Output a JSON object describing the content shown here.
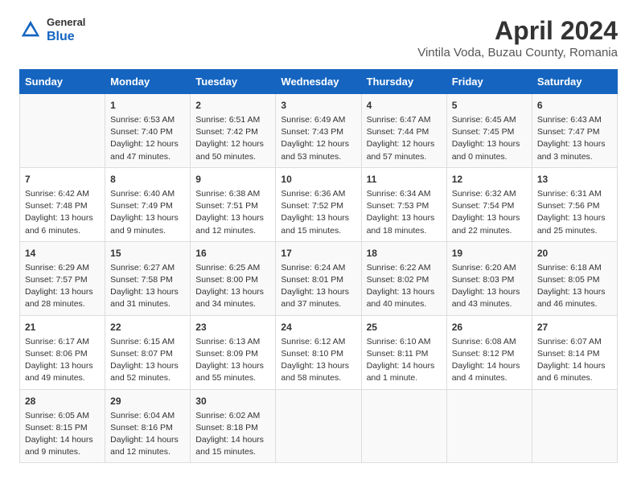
{
  "header": {
    "logo_general": "General",
    "logo_blue": "Blue",
    "title": "April 2024",
    "subtitle": "Vintila Voda, Buzau County, Romania"
  },
  "columns": [
    "Sunday",
    "Monday",
    "Tuesday",
    "Wednesday",
    "Thursday",
    "Friday",
    "Saturday"
  ],
  "weeks": [
    {
      "cells": [
        {
          "day": "",
          "content": ""
        },
        {
          "day": "1",
          "content": "Sunrise: 6:53 AM\nSunset: 7:40 PM\nDaylight: 12 hours\nand 47 minutes."
        },
        {
          "day": "2",
          "content": "Sunrise: 6:51 AM\nSunset: 7:42 PM\nDaylight: 12 hours\nand 50 minutes."
        },
        {
          "day": "3",
          "content": "Sunrise: 6:49 AM\nSunset: 7:43 PM\nDaylight: 12 hours\nand 53 minutes."
        },
        {
          "day": "4",
          "content": "Sunrise: 6:47 AM\nSunset: 7:44 PM\nDaylight: 12 hours\nand 57 minutes."
        },
        {
          "day": "5",
          "content": "Sunrise: 6:45 AM\nSunset: 7:45 PM\nDaylight: 13 hours\nand 0 minutes."
        },
        {
          "day": "6",
          "content": "Sunrise: 6:43 AM\nSunset: 7:47 PM\nDaylight: 13 hours\nand 3 minutes."
        }
      ]
    },
    {
      "cells": [
        {
          "day": "7",
          "content": "Sunrise: 6:42 AM\nSunset: 7:48 PM\nDaylight: 13 hours\nand 6 minutes."
        },
        {
          "day": "8",
          "content": "Sunrise: 6:40 AM\nSunset: 7:49 PM\nDaylight: 13 hours\nand 9 minutes."
        },
        {
          "day": "9",
          "content": "Sunrise: 6:38 AM\nSunset: 7:51 PM\nDaylight: 13 hours\nand 12 minutes."
        },
        {
          "day": "10",
          "content": "Sunrise: 6:36 AM\nSunset: 7:52 PM\nDaylight: 13 hours\nand 15 minutes."
        },
        {
          "day": "11",
          "content": "Sunrise: 6:34 AM\nSunset: 7:53 PM\nDaylight: 13 hours\nand 18 minutes."
        },
        {
          "day": "12",
          "content": "Sunrise: 6:32 AM\nSunset: 7:54 PM\nDaylight: 13 hours\nand 22 minutes."
        },
        {
          "day": "13",
          "content": "Sunrise: 6:31 AM\nSunset: 7:56 PM\nDaylight: 13 hours\nand 25 minutes."
        }
      ]
    },
    {
      "cells": [
        {
          "day": "14",
          "content": "Sunrise: 6:29 AM\nSunset: 7:57 PM\nDaylight: 13 hours\nand 28 minutes."
        },
        {
          "day": "15",
          "content": "Sunrise: 6:27 AM\nSunset: 7:58 PM\nDaylight: 13 hours\nand 31 minutes."
        },
        {
          "day": "16",
          "content": "Sunrise: 6:25 AM\nSunset: 8:00 PM\nDaylight: 13 hours\nand 34 minutes."
        },
        {
          "day": "17",
          "content": "Sunrise: 6:24 AM\nSunset: 8:01 PM\nDaylight: 13 hours\nand 37 minutes."
        },
        {
          "day": "18",
          "content": "Sunrise: 6:22 AM\nSunset: 8:02 PM\nDaylight: 13 hours\nand 40 minutes."
        },
        {
          "day": "19",
          "content": "Sunrise: 6:20 AM\nSunset: 8:03 PM\nDaylight: 13 hours\nand 43 minutes."
        },
        {
          "day": "20",
          "content": "Sunrise: 6:18 AM\nSunset: 8:05 PM\nDaylight: 13 hours\nand 46 minutes."
        }
      ]
    },
    {
      "cells": [
        {
          "day": "21",
          "content": "Sunrise: 6:17 AM\nSunset: 8:06 PM\nDaylight: 13 hours\nand 49 minutes."
        },
        {
          "day": "22",
          "content": "Sunrise: 6:15 AM\nSunset: 8:07 PM\nDaylight: 13 hours\nand 52 minutes."
        },
        {
          "day": "23",
          "content": "Sunrise: 6:13 AM\nSunset: 8:09 PM\nDaylight: 13 hours\nand 55 minutes."
        },
        {
          "day": "24",
          "content": "Sunrise: 6:12 AM\nSunset: 8:10 PM\nDaylight: 13 hours\nand 58 minutes."
        },
        {
          "day": "25",
          "content": "Sunrise: 6:10 AM\nSunset: 8:11 PM\nDaylight: 14 hours\nand 1 minute."
        },
        {
          "day": "26",
          "content": "Sunrise: 6:08 AM\nSunset: 8:12 PM\nDaylight: 14 hours\nand 4 minutes."
        },
        {
          "day": "27",
          "content": "Sunrise: 6:07 AM\nSunset: 8:14 PM\nDaylight: 14 hours\nand 6 minutes."
        }
      ]
    },
    {
      "cells": [
        {
          "day": "28",
          "content": "Sunrise: 6:05 AM\nSunset: 8:15 PM\nDaylight: 14 hours\nand 9 minutes."
        },
        {
          "day": "29",
          "content": "Sunrise: 6:04 AM\nSunset: 8:16 PM\nDaylight: 14 hours\nand 12 minutes."
        },
        {
          "day": "30",
          "content": "Sunrise: 6:02 AM\nSunset: 8:18 PM\nDaylight: 14 hours\nand 15 minutes."
        },
        {
          "day": "",
          "content": ""
        },
        {
          "day": "",
          "content": ""
        },
        {
          "day": "",
          "content": ""
        },
        {
          "day": "",
          "content": ""
        }
      ]
    }
  ]
}
